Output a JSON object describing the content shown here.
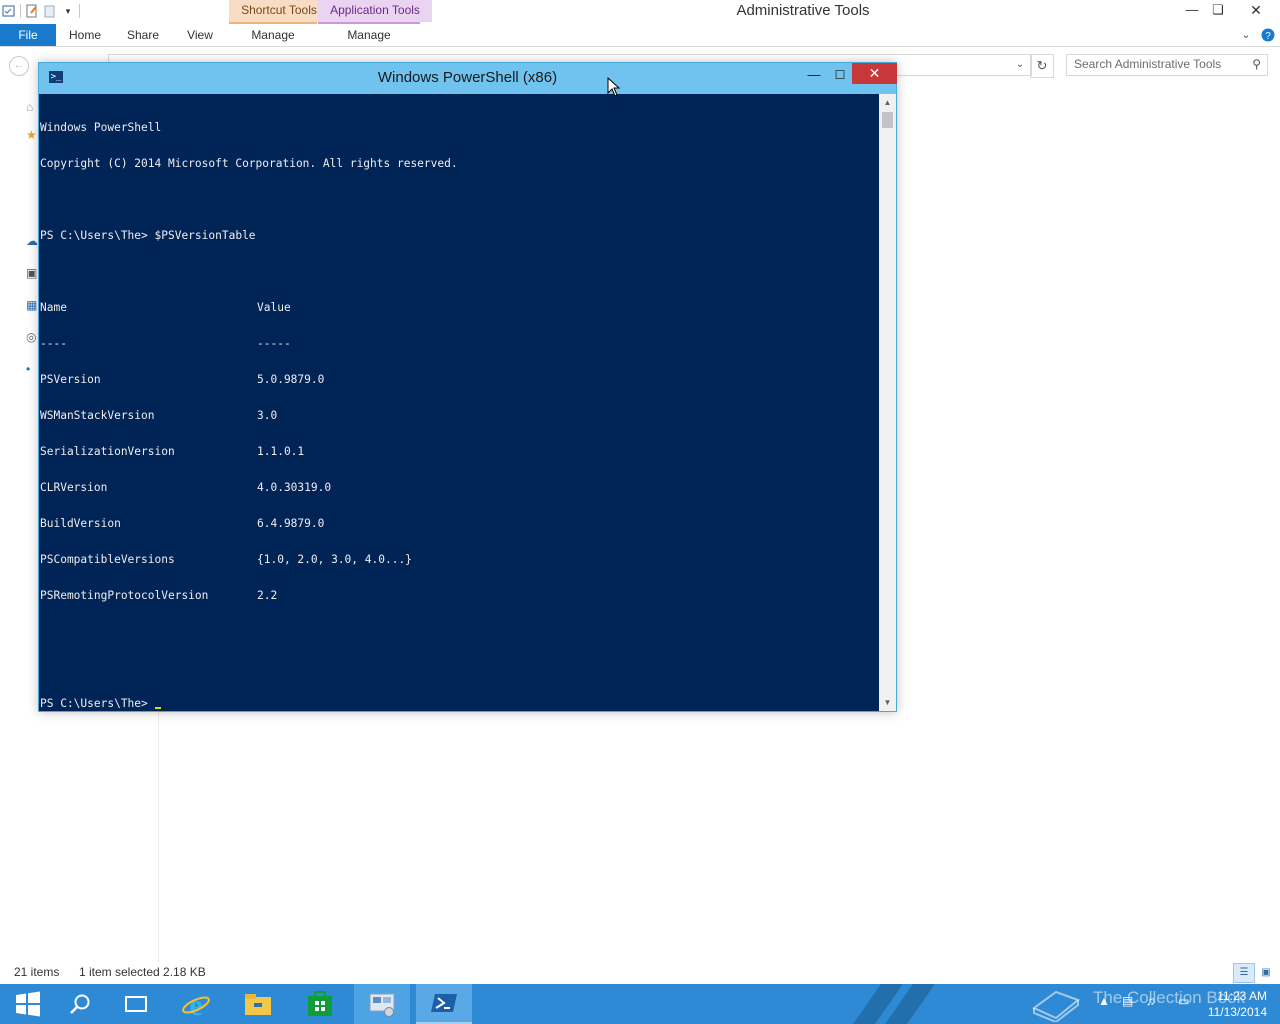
{
  "explorer": {
    "title": "Administrative Tools",
    "contextual_tabs": {
      "shortcut_tools": "Shortcut Tools",
      "application_tools": "Application Tools"
    },
    "ribbon_tabs": {
      "file": "File",
      "home": "Home",
      "share": "Share",
      "view": "View",
      "manage_shortcut": "Manage",
      "manage_app": "Manage"
    },
    "search_placeholder": "Search Administrative Tools",
    "status": {
      "item_count": "21 items",
      "selection": "1 item selected  2.18 KB"
    }
  },
  "powershell": {
    "title": "Windows PowerShell (x86)",
    "header_lines": [
      "Windows PowerShell",
      "Copyright (C) 2014 Microsoft Corporation. All rights reserved."
    ],
    "command_line": "PS C:\\Users\\The> $PSVersionTable",
    "table": {
      "header": {
        "name": "Name",
        "value": "Value"
      },
      "divider": {
        "name": "----",
        "value": "-----"
      },
      "rows": [
        {
          "name": "PSVersion",
          "value": "5.0.9879.0"
        },
        {
          "name": "WSManStackVersion",
          "value": "3.0"
        },
        {
          "name": "SerializationVersion",
          "value": "1.1.0.1"
        },
        {
          "name": "CLRVersion",
          "value": "4.0.30319.0"
        },
        {
          "name": "BuildVersion",
          "value": "6.4.9879.0"
        },
        {
          "name": "PSCompatibleVersions",
          "value": "{1.0, 2.0, 3.0, 4.0...}"
        },
        {
          "name": "PSRemotingProtocolVersion",
          "value": "2.2"
        }
      ]
    },
    "prompt": "PS C:\\Users\\The>",
    "accent_color": "#012456"
  },
  "taskbar": {
    "watermark": "The Collection Book",
    "clock_time": "11:23 AM",
    "clock_date": "11/13/2014"
  }
}
